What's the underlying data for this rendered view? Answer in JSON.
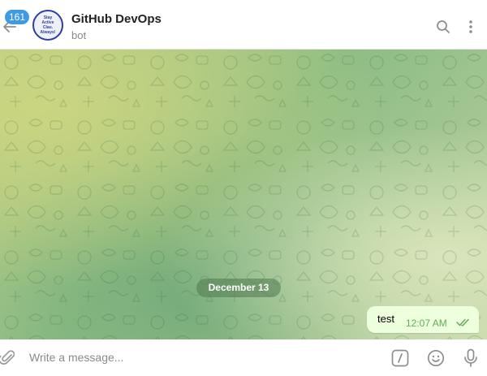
{
  "header": {
    "title": "GitHub DevOps",
    "subtitle": "bot",
    "unread_count": "161",
    "avatar_text": "Stay\nActive\nClau.\nAlways!"
  },
  "chat": {
    "date_separator": "December 13",
    "messages": [
      {
        "text": "test",
        "time": "12:07 AM",
        "status": "read"
      }
    ]
  },
  "composer": {
    "placeholder": "Write a message..."
  },
  "icons": {
    "back": "arrow-left-icon",
    "search": "search-icon",
    "more": "more-vertical-icon",
    "attach": "paperclip-icon",
    "commands": "bot-commands-icon",
    "emoji": "emoji-icon",
    "mic": "microphone-icon",
    "read_check": "double-check-icon"
  },
  "colors": {
    "badge": "#3f9ae2",
    "bubble_out": "#eeffde",
    "time_out": "#5fad56"
  }
}
